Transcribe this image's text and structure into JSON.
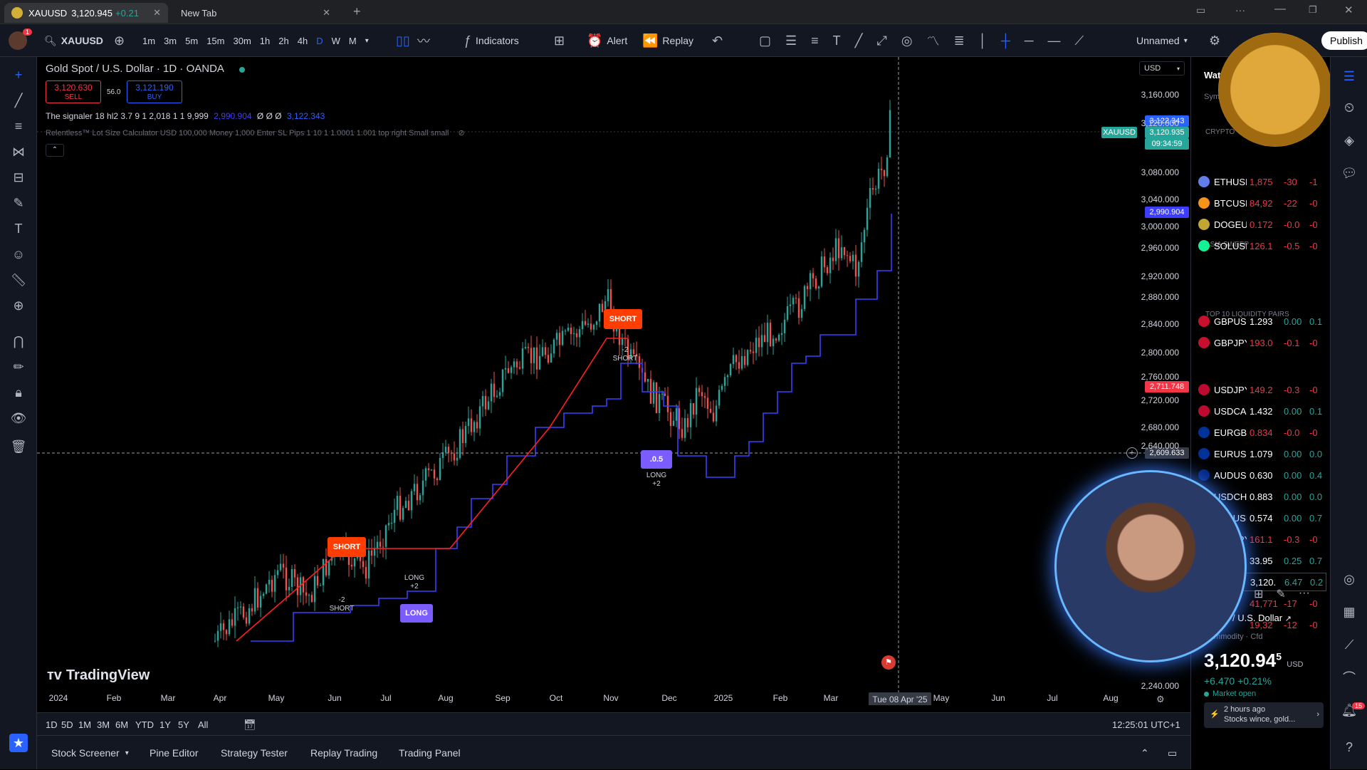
{
  "browser": {
    "tab1_title": "XAUUSD",
    "tab1_price": "3,120.945",
    "tab1_change": "+0.21",
    "tab2_title": "New Tab"
  },
  "toolbar": {
    "symbol": "XAUUSD",
    "intervals": [
      "1m",
      "3m",
      "5m",
      "15m",
      "30m",
      "1h",
      "2h",
      "4h",
      "D",
      "W",
      "M"
    ],
    "indicators_label": "Indicators",
    "alert_label": "Alert",
    "replay_label": "Replay",
    "layout_name": "Unnamed",
    "publish_label": "Publish",
    "notif_count": "1"
  },
  "chart": {
    "title": "Gold Spot / U.S. Dollar · 1D · OANDA",
    "sell_price": "3,120.630",
    "sell_label": "SELL",
    "spread": "56.0",
    "buy_price": "3,121.190",
    "buy_label": "BUY",
    "indicator1": "The signaler 18 hl2 3.7 9 1 2,018 1 1 9,999",
    "indicator1_val1": "2,990.904",
    "indicator1_sym": "Ø Ø Ø",
    "indicator1_val2": "3,122.343",
    "indicator2": "Relentless™ Lot Size Calculator USD 100,000 Money 1,000 Enter SL Pips 1 10 1 1.0001 1.001 top right Small small",
    "currency": "USD",
    "watermark": "TradingView",
    "crosshair_date": "Tue 08 Apr '25",
    "crosshair_price": "2,609.633",
    "time_display": "12:25:01 UTC+1",
    "price_tags": {
      "t1": "3,122.343",
      "symbol": "XAUUSD",
      "last": "3,120.935",
      "countdown": "09:34:59",
      "t3": "2,990.904",
      "t4": "2,711.748"
    },
    "signals": {
      "short1": "SHORT",
      "short2": "SHORT",
      "long1": "LONG",
      "long2": ".0.5",
      "sub_short1": "-2\nSHORT",
      "sub_short2": "-2\nSHORT",
      "sub_long1": "LONG\n+2",
      "sub_long2": "LONG\n+2"
    }
  },
  "chart_data": {
    "type": "candlestick",
    "title": "Gold Spot / U.S. Dollar · 1D · OANDA",
    "y_ticks": [
      "3,160.000",
      "3,120.000",
      "3,080.000",
      "3,040.000",
      "3,000.000",
      "2,960.000",
      "2,920.000",
      "2,880.000",
      "2,840.000",
      "2,800.000",
      "2,760.000",
      "2,720.000",
      "2,680.000",
      "2,640.000",
      "2,240.000"
    ],
    "x_ticks": [
      "2024",
      "Feb",
      "Mar",
      "Apr",
      "May",
      "Jun",
      "Jul",
      "Aug",
      "Sep",
      "Oct",
      "Nov",
      "Dec",
      "2025",
      "Feb",
      "Mar",
      "Tue 08 Apr '25",
      "May",
      "Jun",
      "Jul",
      "Aug"
    ],
    "close_path": [
      [
        "Apr",
        2300
      ],
      [
        "May",
        2340
      ],
      [
        "Jun",
        2330
      ],
      [
        "Jul",
        2380
      ],
      [
        "Aug",
        2450
      ],
      [
        "Sep",
        2580
      ],
      [
        "Oct",
        2700
      ],
      [
        "Nov",
        2720
      ],
      [
        "Dec",
        2650
      ],
      [
        "2025",
        2640
      ],
      [
        "Feb",
        2870
      ],
      [
        "Mar",
        2920
      ],
      [
        "Apr",
        3120
      ]
    ]
  },
  "range_bar": {
    "ranges": [
      "1D",
      "5D",
      "1M",
      "3M",
      "6M",
      "YTD",
      "1Y",
      "5Y",
      "All"
    ]
  },
  "bottom_panel": {
    "tabs": [
      "Stock Screener",
      "Pine Editor",
      "Strategy Tester",
      "Replay Trading",
      "Trading Panel"
    ]
  },
  "watchlist": {
    "title": "Wat",
    "sym_header": "Sym",
    "sections": [
      "CRYPTO",
      "ASIA SWEEP",
      "TOP 10 LIQUIDITY PAIRS"
    ],
    "rows": [
      {
        "sym": "ETHUSI",
        "last": "1,875",
        "chg": "-30",
        "pct": "-1",
        "color": "#627eea",
        "neg": true
      },
      {
        "sym": "BTCUSI",
        "last": "84,92",
        "chg": "-22",
        "pct": "-0",
        "color": "#f7931a",
        "neg": true
      },
      {
        "sym": "DOGEU",
        "last": "0.172",
        "chg": "-0.0",
        "pct": "-0",
        "color": "#c2a633",
        "neg": true
      },
      {
        "sym": "SOLUSI",
        "last": "126.1",
        "chg": "-0.5",
        "pct": "-0",
        "color": "#14f195",
        "neg": true
      },
      {
        "sym": "GBPUSI",
        "last": "1.293",
        "chg": "0.00",
        "pct": "0.1",
        "color": "#c8102e",
        "neg": false
      },
      {
        "sym": "GBPJPY",
        "last": "193.0",
        "chg": "-0.1",
        "pct": "-0",
        "color": "#c8102e",
        "neg": true
      },
      {
        "sym": "USDJPY",
        "last": "149.2",
        "chg": "-0.3",
        "pct": "-0",
        "color": "#bf0a30",
        "neg": true
      },
      {
        "sym": "USDCAI",
        "last": "1.432",
        "chg": "0.00",
        "pct": "0.1",
        "color": "#bf0a30",
        "neg": false
      },
      {
        "sym": "EURGB",
        "last": "0.834",
        "chg": "-0.0",
        "pct": "-0",
        "color": "#003399",
        "neg": true
      },
      {
        "sym": "EURUSI",
        "last": "1.079",
        "chg": "0.00",
        "pct": "0.0",
        "color": "#003399",
        "neg": false
      },
      {
        "sym": "AUDUS",
        "last": "0.630",
        "chg": "0.00",
        "pct": "0.4",
        "color": "#00247d",
        "neg": false
      },
      {
        "sym": "USDCH",
        "last": "0.883",
        "chg": "0.00",
        "pct": "0.0",
        "color": "#bf0a30",
        "neg": false
      },
      {
        "sym": "NZDUSI",
        "last": "0.574",
        "chg": "0.00",
        "pct": "0.7",
        "color": "#00247d",
        "neg": false
      },
      {
        "sym": "EURJPY",
        "last": "161.1",
        "chg": "-0.3",
        "pct": "-0",
        "color": "#003399",
        "neg": true
      },
      {
        "sym": "GUSI",
        "last": "33.95",
        "chg": "0.25",
        "pct": "0.7",
        "color": "#888888",
        "neg": false
      },
      {
        "sym": "SI",
        "last": "3,120.",
        "chg": "6.47",
        "pct": "0.2",
        "color": "#d4af37",
        "neg": false
      },
      {
        "sym": "",
        "last": "41,771",
        "chg": "-17",
        "pct": "-0",
        "color": "#555555",
        "neg": true
      },
      {
        "sym": "",
        "last": "19,32",
        "chg": "-12",
        "pct": "-0",
        "color": "#555555",
        "neg": true
      }
    ]
  },
  "details": {
    "name": "/ U.S. Dollar",
    "category": "Commodity · Cfd",
    "price": "3,120.94",
    "price_sup": "5",
    "currency": "USD",
    "change": "+6.470 +0.21%",
    "status": "Market open",
    "news_time": "2 hours ago",
    "news_text": "Stocks wince, gold..."
  },
  "rightbar": {
    "badge": "15"
  },
  "colors": {
    "up": "#26a69a",
    "down": "#ef5350",
    "short": "#ff3d00",
    "long": "#7b5cff",
    "accent": "#2962ff"
  }
}
